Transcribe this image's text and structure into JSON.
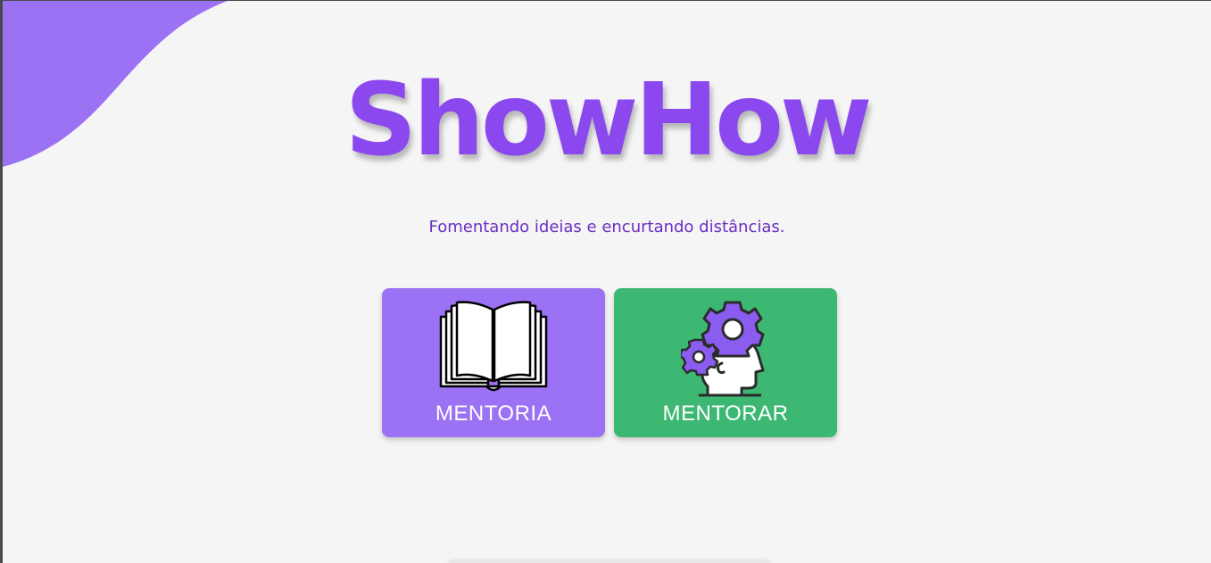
{
  "brand": {
    "title": "ShowHow",
    "tagline": "Fomentando ideias e encurtando distâncias."
  },
  "cards": [
    {
      "label": "MENTORIA",
      "icon": "open-book-icon",
      "color": "#9b72f4"
    },
    {
      "label": "MENTORAR",
      "icon": "head-gears-icon",
      "color": "#3db873"
    }
  ],
  "colors": {
    "accent": "#8a48ee",
    "tagline": "#6a2fc2",
    "background": "#f5f5f5"
  }
}
